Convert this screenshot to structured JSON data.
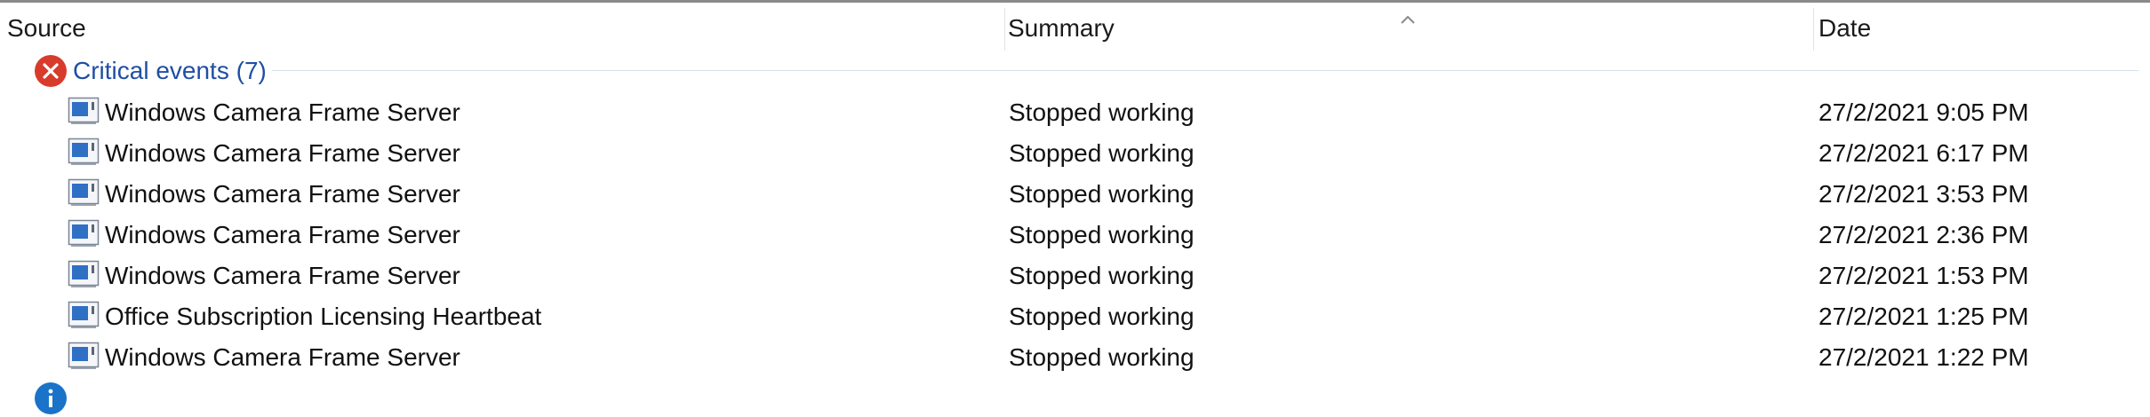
{
  "columns": {
    "source": "Source",
    "summary": "Summary",
    "date": "Date"
  },
  "sort": {
    "column": "Summary",
    "direction": "ascending"
  },
  "group": {
    "label": "Critical events (7)",
    "icon": "error-x-icon",
    "color": "#1f4fa3"
  },
  "events": [
    {
      "source": "Windows Camera Frame Server",
      "summary": "Stopped working",
      "date": "27/2/2021 9:05 PM"
    },
    {
      "source": "Windows Camera Frame Server",
      "summary": "Stopped working",
      "date": "27/2/2021 6:17 PM"
    },
    {
      "source": "Windows Camera Frame Server",
      "summary": "Stopped working",
      "date": "27/2/2021 3:53 PM"
    },
    {
      "source": "Windows Camera Frame Server",
      "summary": "Stopped working",
      "date": "27/2/2021 2:36 PM"
    },
    {
      "source": "Windows Camera Frame Server",
      "summary": "Stopped working",
      "date": "27/2/2021 1:53 PM"
    },
    {
      "source": "Office Subscription Licensing Heartbeat",
      "summary": "Stopped working",
      "date": "27/2/2021 1:25 PM"
    },
    {
      "source": "Windows Camera Frame Server",
      "summary": "Stopped working",
      "date": "27/2/2021 1:22 PM"
    }
  ],
  "next_group": {
    "icon": "info-icon"
  },
  "colors": {
    "error_icon": "#d83b2b",
    "info_icon": "#1a73c9",
    "group_text": "#1f4fa3"
  }
}
